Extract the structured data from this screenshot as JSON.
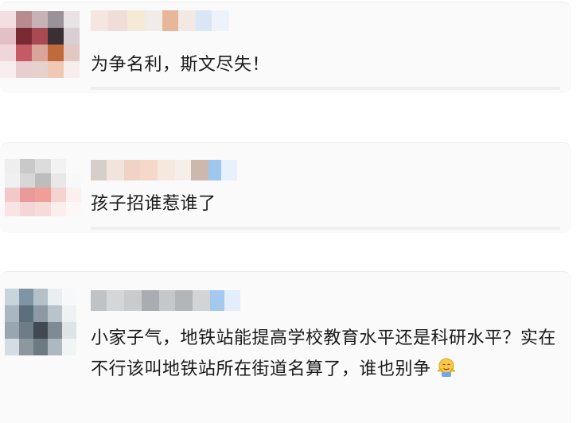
{
  "comments": [
    {
      "text": "为争名利，斯文尽失！",
      "avatar_colors": [
        "#f3dfe2",
        "#b98a8f",
        "#c7b2b6",
        "#9a9298",
        "#e9e3e6",
        "#e3c0c6",
        "#7a2a33",
        "#a94a53",
        "#3a2f34",
        "#d9cfd3",
        "#efd6da",
        "#c45a63",
        "#d9a59b",
        "#c06a3c",
        "#e2c7c2",
        "#f8eeef",
        "#e8cdd1",
        "#e6d1cc",
        "#f0c8b4",
        "#f6eeec"
      ],
      "username_colors": [
        "#f5e6e2",
        "#f0ddd8",
        "#f4ead6",
        "#f1ece8",
        "#e6b899",
        "#f2e9e4",
        "#d8e6f6",
        "#eef3fb"
      ]
    },
    {
      "text": "孩子招谁惹谁了",
      "avatar_colors": [
        "#eeeeee",
        "#c9c9c9",
        "#dcdcdc",
        "#f2f2f2",
        "#fafafa",
        "#f0f0f0",
        "#d7d7d7",
        "#bdbdbd",
        "#e8e8e8",
        "#f8f8f8",
        "#f3c8c8",
        "#e99a9a",
        "#ef9f98",
        "#f5d3cf",
        "#fbf0ee",
        "#f8e4e4",
        "#f4d6d6",
        "#f6dcd8",
        "#fbeeed",
        "#fdf8f7"
      ],
      "username_colors": [
        "#d6cfc9",
        "#f1e4dc",
        "#f0d3c6",
        "#f6d8c8",
        "#f7e8df",
        "#f6efe9",
        "#cdb8ad",
        "#9fc7ee",
        "#e6f1fb"
      ]
    },
    {
      "text": "小家子气，地铁站能提高学校教育水平还是科研水平？实在不行该叫地铁站所在街道名算了，谁也别争",
      "avatar_colors": [
        "#c7d4dc",
        "#7f95a6",
        "#b4c1c9",
        "#e9eef1",
        "#f6f8f9",
        "#aab7c0",
        "#5c6f7c",
        "#8e9aa3",
        "#b8c3ca",
        "#eef2f4",
        "#9aa6af",
        "#6d7c87",
        "#414a51",
        "#7f8a92",
        "#dde3e6",
        "#d6dde2",
        "#8c979e",
        "#6e7a82",
        "#aeb8be",
        "#f1f4f5"
      ],
      "username_colors": [
        "#bfc3c6",
        "#d4d7d9",
        "#c9cbcd",
        "#a9adb1",
        "#c5c8cb",
        "#b3b6b9",
        "#d2d4d6",
        "#a5c8ee",
        "#e2eefb"
      ],
      "emoji": "shrug-emoji"
    }
  ]
}
